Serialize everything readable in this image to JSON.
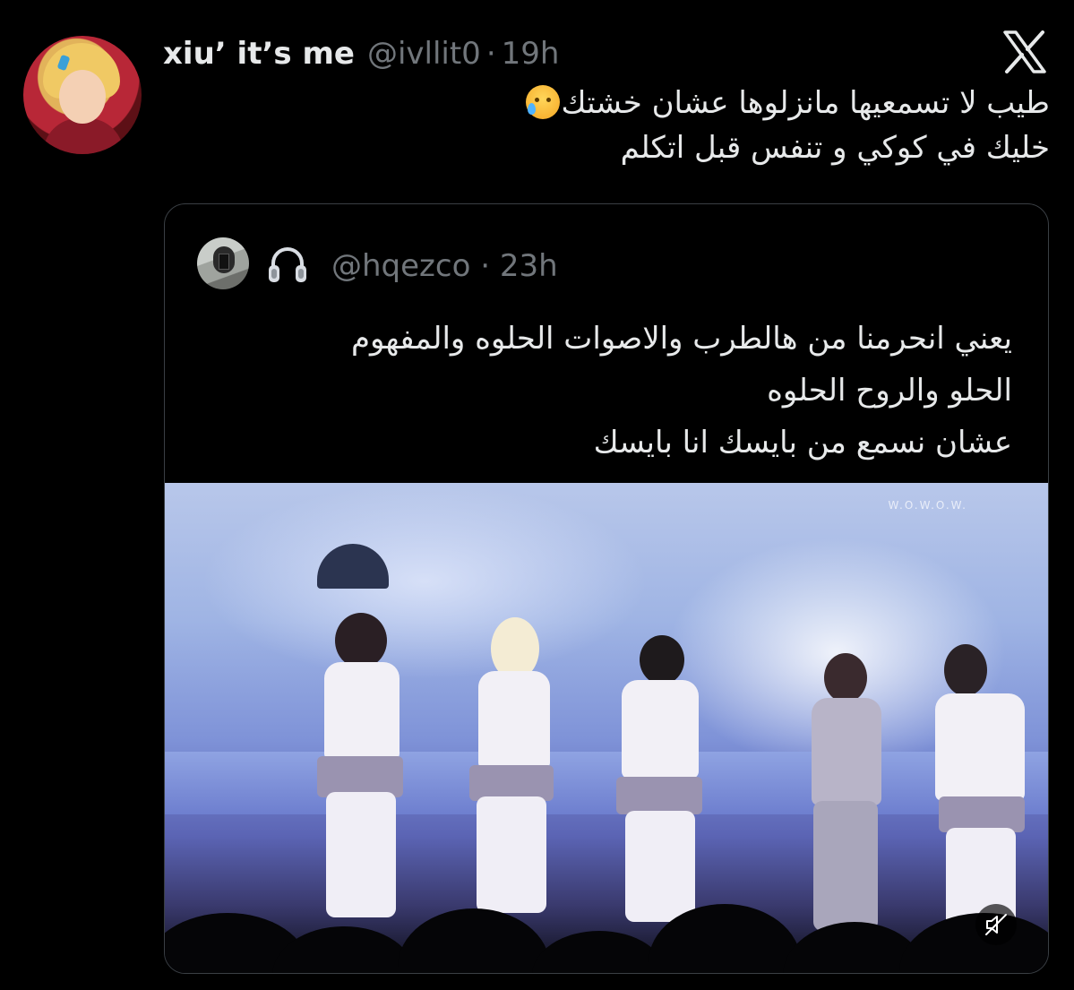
{
  "tweet": {
    "display_name": "xiu’ it’s me",
    "handle": "@ivllit0",
    "separator": "·",
    "time": "19h",
    "lines": [
      "طيب لا تسمعيها مانزلوها عشان خشتك",
      "خليك في كوكي و تنفس قبل اتكلم"
    ],
    "emoji": "sad-but-relieved-face"
  },
  "quoted_tweet": {
    "handle": "@hqezco",
    "separator": "·",
    "time": "23h",
    "name_icon": "headphones-icon",
    "lines": [
      "يعني انحرمنا من هالطرب والاصوات الحلوه والمفهوم",
      "الحلو والروح الحلوه",
      "عشان نسمع من بايسك انا بايسك"
    ],
    "media": {
      "watermark": "W.O.W.O.W.",
      "muted": true
    }
  },
  "colors": {
    "background": "#000000",
    "text": "#e7e9ea",
    "secondary": "#71767b",
    "border": "#3a3f44"
  }
}
